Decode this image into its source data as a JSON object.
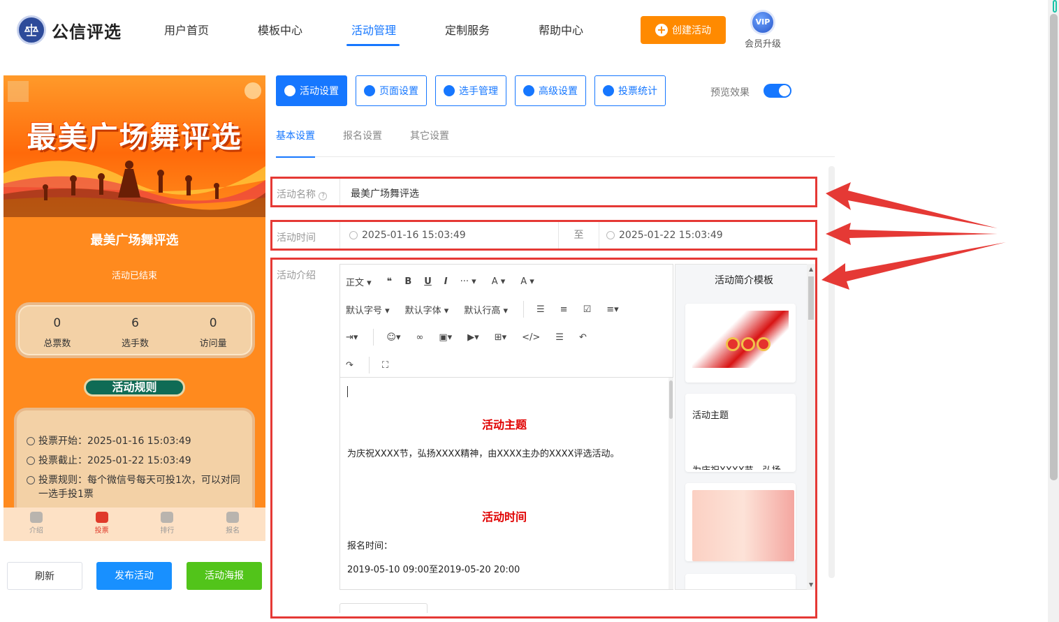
{
  "brand": {
    "name": "公信评选"
  },
  "nav": [
    {
      "label": "用户首页"
    },
    {
      "label": "模板中心"
    },
    {
      "label": "活动管理",
      "active": true
    },
    {
      "label": "定制服务"
    },
    {
      "label": "帮助中心"
    }
  ],
  "header": {
    "create_label": "创建活动",
    "vip_badge": "VIP",
    "vip_label": "会员升级"
  },
  "preview": {
    "banner_title": "最美广场舞评选",
    "activity_name": "最美广场舞评选",
    "status": "活动已结束",
    "stats": [
      {
        "value": "0",
        "label": "总票数"
      },
      {
        "value": "6",
        "label": "选手数"
      },
      {
        "value": "0",
        "label": "访问量"
      }
    ],
    "rules_title": "活动规则",
    "rules": [
      "投票开始：2025-01-16 15:03:49",
      "投票截止：2025-01-22 15:03:49",
      "投票规则：每个微信号每天可投1次，可以对同一选手投1票"
    ],
    "tabs": [
      {
        "label": "介绍"
      },
      {
        "label": "投票",
        "active": true
      },
      {
        "label": "排行"
      },
      {
        "label": "报名"
      }
    ]
  },
  "actions": {
    "refresh": "刷新",
    "publish": "发布活动",
    "poster": "活动海报"
  },
  "tools": [
    {
      "label": "活动设置",
      "active": true,
      "icon": "star-icon"
    },
    {
      "label": "页面设置",
      "icon": "gear-icon"
    },
    {
      "label": "选手管理",
      "icon": "users-icon"
    },
    {
      "label": "高级设置",
      "icon": "settings-icon"
    },
    {
      "label": "投票统计",
      "icon": "chart-icon"
    }
  ],
  "preview_toggle": {
    "label": "预览效果",
    "on": true
  },
  "subtabs": [
    {
      "label": "基本设置",
      "active": true
    },
    {
      "label": "报名设置"
    },
    {
      "label": "其它设置"
    }
  ],
  "form": {
    "name_label": "活动名称",
    "name_value": "最美广场舞评选",
    "time_label": "活动时间",
    "start_time": "2025-01-16 15:03:49",
    "time_sep": "至",
    "end_time": "2025-01-22 15:03:49",
    "intro_label": "活动介绍"
  },
  "editor": {
    "toolbar_row1": [
      "正文 ▾",
      "❝",
      "B",
      "U",
      "I",
      "··· ▾",
      "A ▾",
      "A ▾"
    ],
    "toolbar_row2": [
      "默认字号 ▾",
      "默认字体 ▾",
      "默认行高 ▾"
    ],
    "content": {
      "h1": "活动主题",
      "p1": "为庆祝XXXX节，弘扬XXXX精神，由XXXX主办的XXXX评选活动。",
      "h2": "活动时间",
      "p2": "报名时间：",
      "p3": "2019-05-10 09:00至2019-05-20 20:00"
    }
  },
  "templates": {
    "title": "活动简介模板",
    "card2_title": "活动主题",
    "card2_sub": "为庆祝XXXX节，弘扬"
  },
  "colors": {
    "primary": "#1677ff",
    "orange": "#ff8a00",
    "highlight": "#e53935",
    "publish": "#1890ff",
    "poster": "#52c41a"
  }
}
